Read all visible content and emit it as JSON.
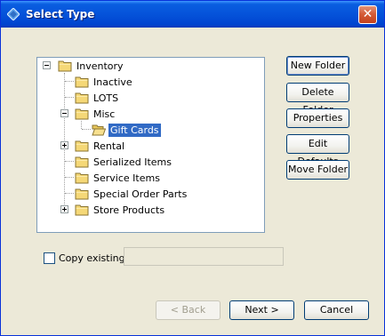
{
  "window": {
    "title": "Select Type",
    "close_label": "✕"
  },
  "tree": {
    "items": [
      {
        "label": "Inventory",
        "expander": "minus"
      },
      {
        "label": "Inactive"
      },
      {
        "label": "LOTS"
      },
      {
        "label": "Misc",
        "expander": "minus"
      },
      {
        "label": "Gift Cards",
        "selected": true,
        "open_folder": true
      },
      {
        "label": "Rental",
        "expander": "plus"
      },
      {
        "label": "Serialized Items"
      },
      {
        "label": "Service Items"
      },
      {
        "label": "Special Order Parts"
      },
      {
        "label": "Store Products",
        "expander": "plus"
      }
    ]
  },
  "side_buttons": {
    "new_folder": "New Folder",
    "delete_folder": "Delete Folder",
    "properties": "Properties",
    "edit_defaults": "Edit Defaults",
    "move_folder": "Move Folder"
  },
  "copy_existing": {
    "label": "Copy existing:",
    "checked": false,
    "value": ""
  },
  "footer": {
    "back": "< Back",
    "next": "Next >",
    "cancel": "Cancel"
  },
  "colors": {
    "title_bar": "#0553da",
    "selection": "#316ac5",
    "folder": "#f5d877"
  }
}
